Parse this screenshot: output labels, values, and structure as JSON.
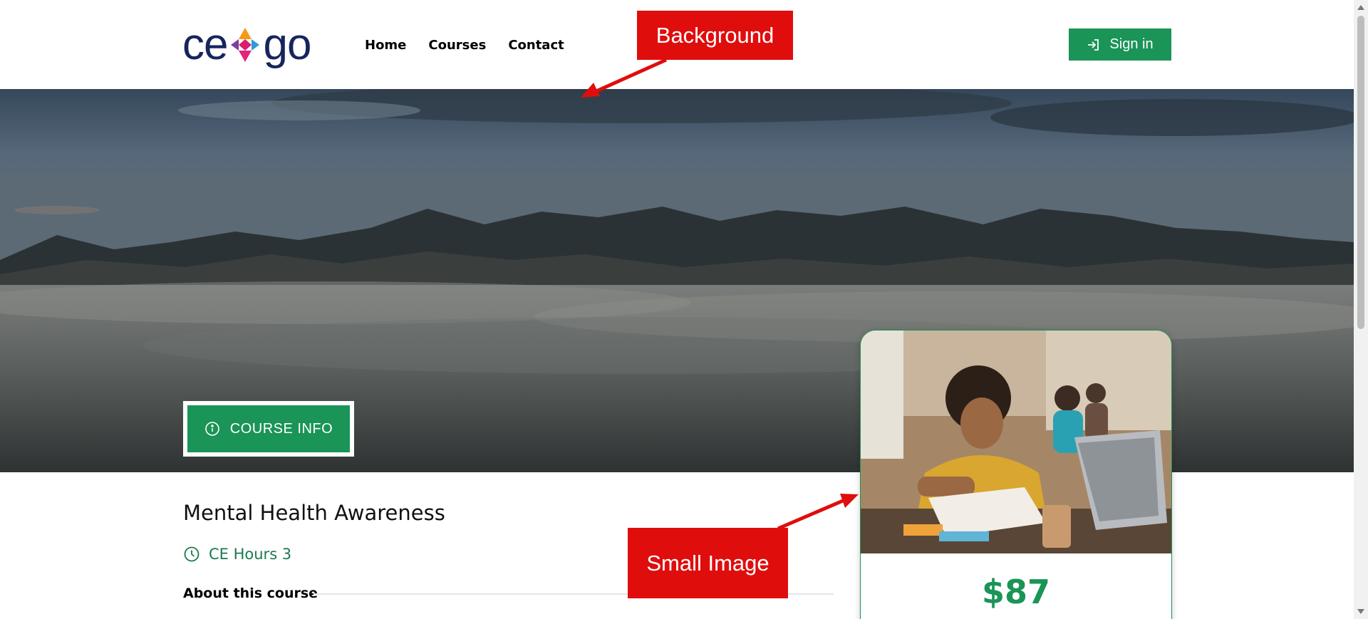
{
  "header": {
    "logo_text_left": "ce",
    "logo_text_right": "go",
    "nav": [
      {
        "label": "Home"
      },
      {
        "label": "Courses"
      },
      {
        "label": "Contact"
      }
    ],
    "signin_label": "Sign in"
  },
  "hero": {
    "course_info_label": "COURSE INFO"
  },
  "course": {
    "title": "Mental Health Awareness",
    "ce_hours": "CE Hours 3",
    "about_heading": "About this course",
    "price": "$87"
  },
  "annotations": {
    "background": "Background",
    "small_image": "Small Image"
  },
  "colors": {
    "brand_green": "#1a9457",
    "logo_navy": "#16255d",
    "annotation_red": "#e00d0d"
  },
  "icons": [
    "signin-icon",
    "info-icon",
    "clock-icon"
  ]
}
